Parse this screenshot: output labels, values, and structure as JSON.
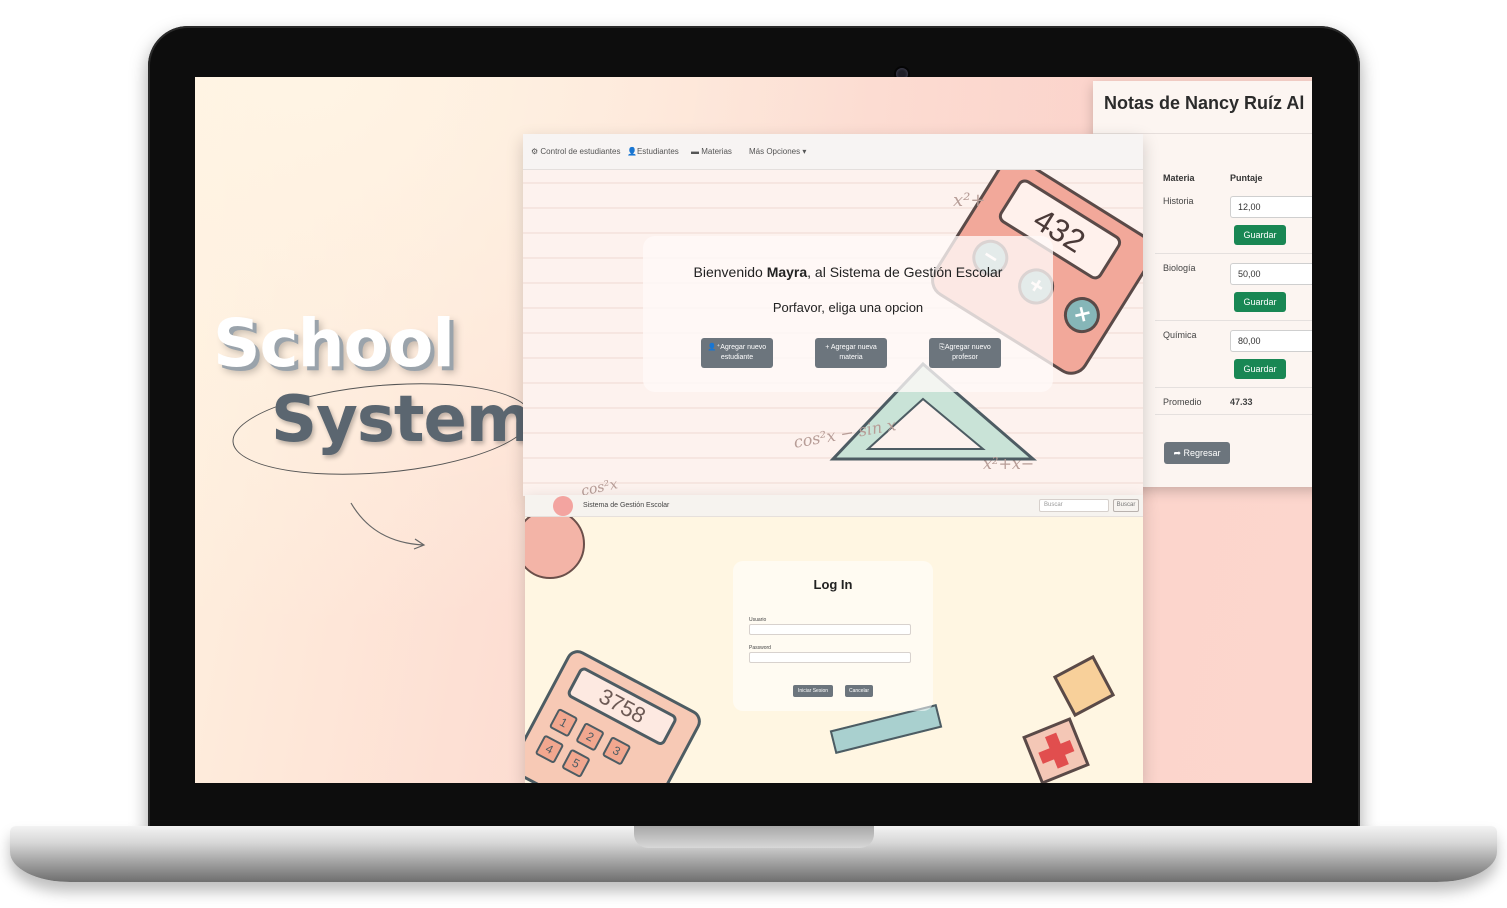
{
  "hero": {
    "line1": "School",
    "line2": "System"
  },
  "grades": {
    "title": "Notas de Nancy Ruíz Al",
    "col_subject": "Materia",
    "col_score": "Puntaje",
    "rows": [
      {
        "subject": "Historia",
        "score": "12,00",
        "save": "Guardar"
      },
      {
        "subject": "Biología",
        "score": "50,00",
        "save": "Guardar"
      },
      {
        "subject": "Química",
        "score": "80,00",
        "save": "Guardar"
      }
    ],
    "average_label": "Promedio",
    "average_value": "47.33",
    "back_label": "Regresar"
  },
  "welcome": {
    "nav": {
      "brand": "Control de estudiantes",
      "students": "Estudiantes",
      "subjects": "Materias",
      "more": "Más Opciones"
    },
    "greeting_prefix": "Bienvenido ",
    "user": "Mayra",
    "greeting_suffix": ", al Sistema de Gestión Escolar",
    "prompt": "Porfavor, eliga una opcion",
    "buttons": [
      {
        "icon": "user-plus-icon",
        "label": "Agregar nuevo estudiante"
      },
      {
        "icon": "plus-icon",
        "label": "Agregar nueva materia"
      },
      {
        "icon": "user-add-icon",
        "label": "Agregar nuevo profesor"
      }
    ],
    "calc_display": "432"
  },
  "login": {
    "brand": "Sistema de Gestión Escolar",
    "search_placeholder": "Buscar",
    "search_button": "Buscar",
    "title": "Log In",
    "user_label": "Usuario",
    "password_label": "Password",
    "submit": "Iniciar Sesion",
    "cancel": "Cancelar",
    "calc_display": "3758"
  },
  "colors": {
    "success": "#198754",
    "secondary": "#6c757d",
    "bg_peach": "#fbd3cb"
  }
}
